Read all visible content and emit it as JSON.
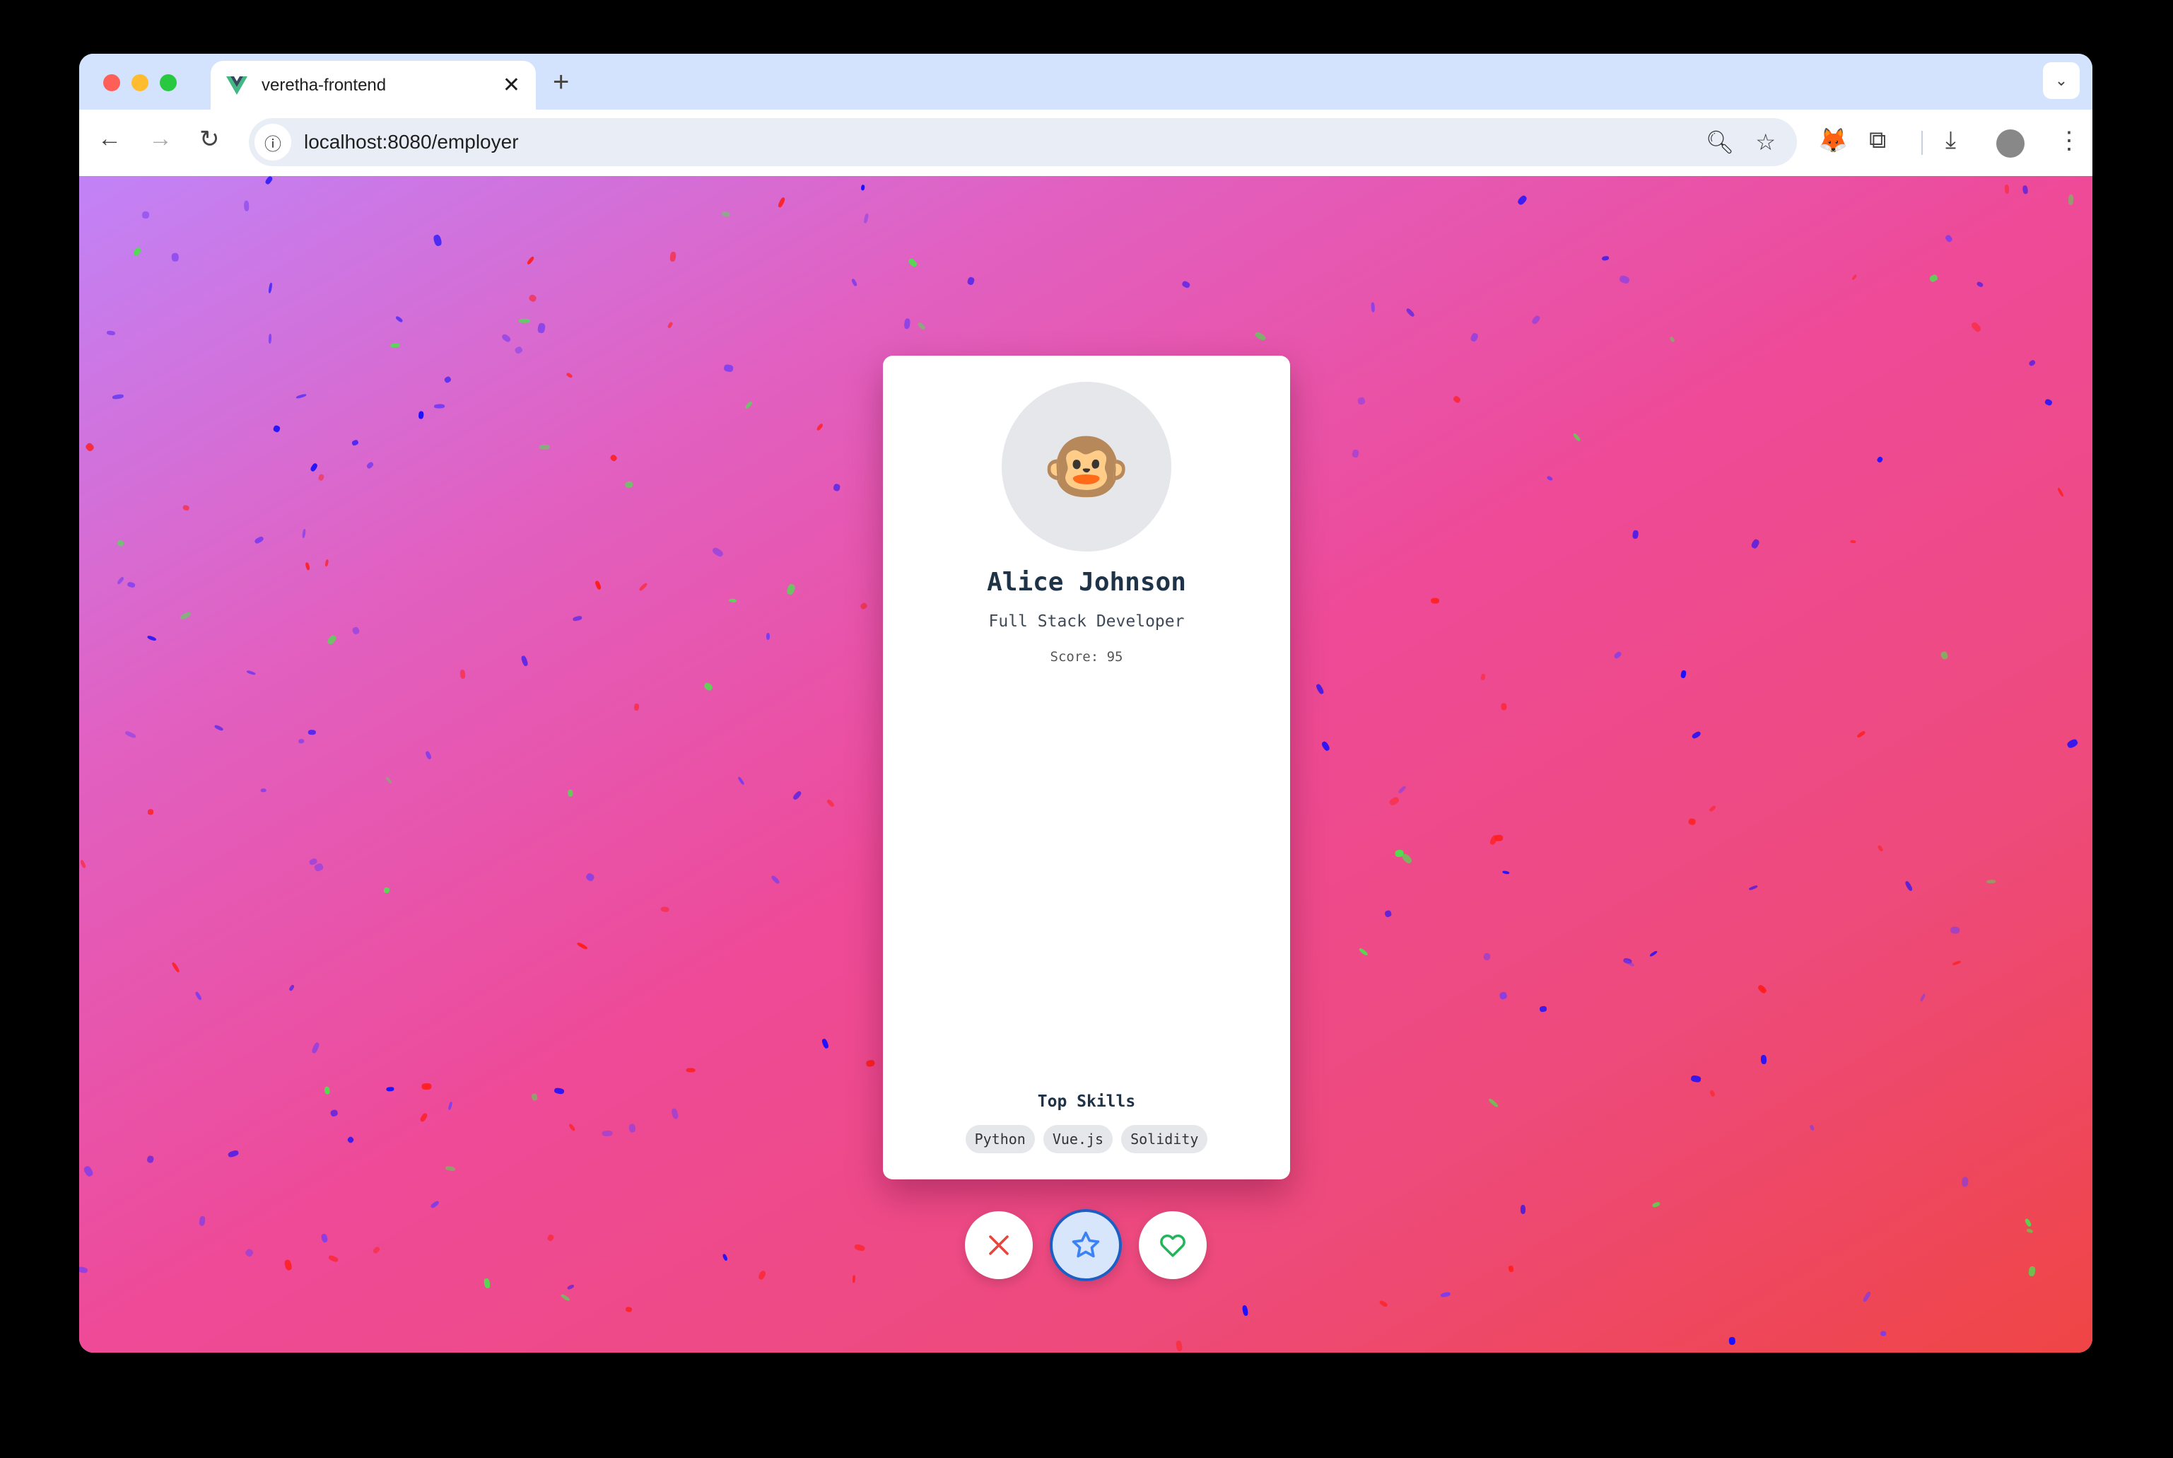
{
  "browser": {
    "tab_title": "veretha-frontend",
    "url": "localhost:8080/employer",
    "traffic_lights": {
      "close": "#fe5f57",
      "minimize": "#febc2e",
      "maximize": "#28c840"
    }
  },
  "profile": {
    "avatar_emoji": "🐵",
    "name": "Alice Johnson",
    "role": "Full Stack Developer",
    "score": "Score: 95",
    "skills_title": "Top Skills",
    "skills": [
      "Python",
      "Vue.js",
      "Solidity"
    ]
  },
  "actions": {
    "reject_icon": "x-icon",
    "superlike_icon": "star-icon",
    "like_icon": "heart-icon"
  },
  "colors": {
    "reject": "#e8453c",
    "superlike": "#3b82f6",
    "like": "#22b45a",
    "confetti": [
      "#1a10ff",
      "#ff1f1f",
      "#4ee04e",
      "#7a3cf0"
    ]
  }
}
